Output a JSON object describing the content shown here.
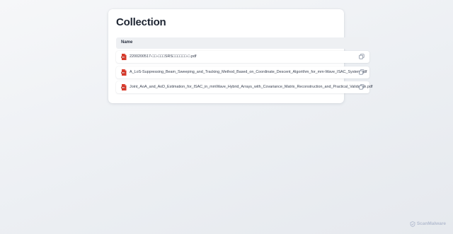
{
  "page": {
    "title": "Collection"
  },
  "table": {
    "columns": [
      "Name"
    ],
    "rows": [
      {
        "file_name": "2200200517-□□-□□□SRS□□□□□□-□.pdf",
        "icon": "pdf-file-icon",
        "action_icon": "copy-icon"
      },
      {
        "file_name": "A_LoS-Suppressing_Beam_Sweeping_and_Tracking_Method_Based_on_Coordinate_Descent_Algorithm_for_mm-Wave_ISAC_System.pdf",
        "icon": "pdf-file-icon",
        "action_icon": "copy-icon"
      },
      {
        "file_name": "Joint_AoA_and_AoD_Estimation_for_ISAC_in_mmWave_Hybrid_Arrays_with_Covariance_Matrix_Reconstruction_and_Practical_Validation.pdf",
        "icon": "pdf-file-icon",
        "action_icon": "copy-icon"
      }
    ]
  },
  "watermark": {
    "text": "ScanMalware",
    "icon": "scanmalware-logo-icon"
  },
  "colors": {
    "pdf_icon": "#d93a2b",
    "title": "#1e2532",
    "header_bg": "#eef0f3",
    "watermark": "#b4bdd0"
  }
}
